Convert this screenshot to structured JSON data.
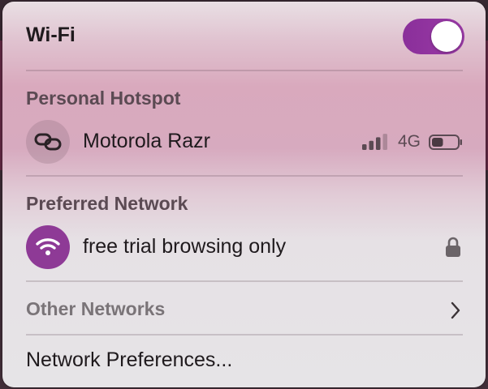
{
  "wifi": {
    "title": "Wi-Fi",
    "enabled": true,
    "toggle_color": "#8e3a96"
  },
  "personal_hotspot": {
    "header": "Personal Hotspot",
    "device": {
      "name": "Motorola Razr",
      "icon": "link-icon",
      "signal_bars": 3,
      "signal_bars_max": 4,
      "network_type": "4G",
      "battery_level": 0.45
    }
  },
  "preferred_network": {
    "header": "Preferred Network",
    "network": {
      "name": "free trial browsing only",
      "icon": "wifi-icon",
      "secured": true,
      "icon_color": "#8e3a96"
    }
  },
  "other_networks": {
    "label": "Other Networks"
  },
  "network_preferences": {
    "label": "Network Preferences..."
  }
}
